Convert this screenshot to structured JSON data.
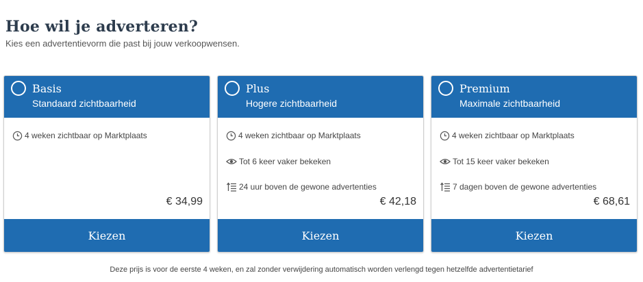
{
  "header": {
    "title": "Hoe wil je adverteren?",
    "subtitle": "Kies een advertentievorm die past bij jouw verkoopwensen."
  },
  "plans": [
    {
      "name": "Basis",
      "subtitle": "Standaard zichtbaarheid",
      "features": [
        {
          "icon": "clock-icon",
          "text": "4 weken zichtbaar op Marktplaats"
        }
      ],
      "price": "€ 34,99",
      "button": "Kiezen"
    },
    {
      "name": "Plus",
      "subtitle": "Hogere zichtbaarheid",
      "features": [
        {
          "icon": "clock-icon",
          "text": "4 weken zichtbaar op Marktplaats"
        },
        {
          "icon": "eye-icon",
          "text": "Tot 6 keer vaker bekeken"
        },
        {
          "icon": "top-listing-icon",
          "text": "24 uur boven de gewone advertenties"
        }
      ],
      "price": "€ 42,18",
      "button": "Kiezen"
    },
    {
      "name": "Premium",
      "subtitle": "Maximale zichtbaarheid",
      "features": [
        {
          "icon": "clock-icon",
          "text": "4 weken zichtbaar op Marktplaats"
        },
        {
          "icon": "eye-icon",
          "text": "Tot 15 keer vaker bekeken"
        },
        {
          "icon": "top-listing-icon",
          "text": "7 dagen boven de gewone advertenties"
        }
      ],
      "price": "€ 68,61",
      "button": "Kiezen"
    }
  ],
  "footnote": "Deze prijs is voor de eerste 4 weken, en zal zonder verwijdering automatisch worden verlengd tegen hetzelfde advertentietarief",
  "colors": {
    "accent": "#1f6cb1",
    "title": "#2d3c4d"
  }
}
